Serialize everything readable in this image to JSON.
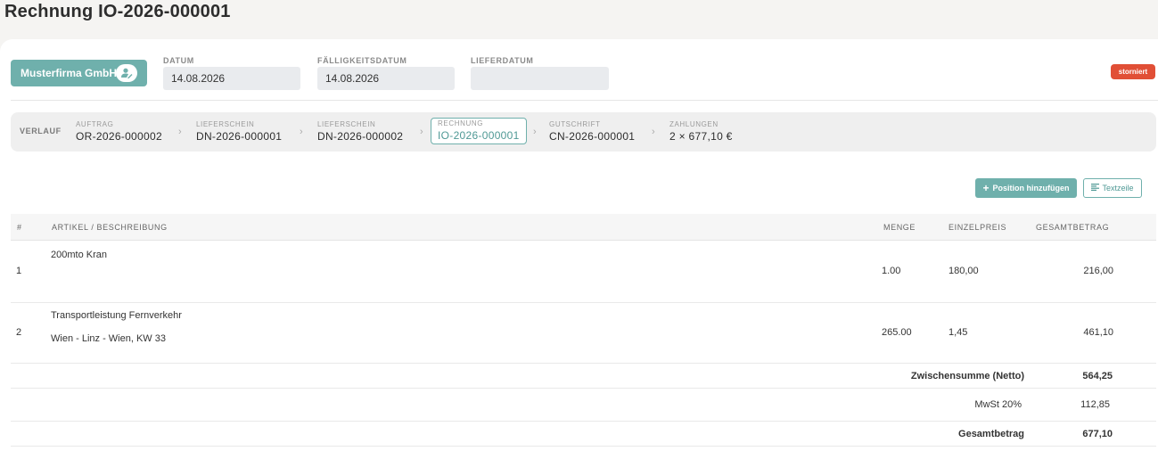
{
  "page": {
    "title": "Rechnung IO-2026-000001"
  },
  "header": {
    "customer": "Musterfirma GmbH",
    "date": {
      "label": "DATUM",
      "value": "14.08.2026"
    },
    "due_date": {
      "label": "FÄLLIGKEITSDATUM",
      "value": "14.08.2026"
    },
    "delivery_date": {
      "label": "LIEFERDATUM",
      "value": ""
    },
    "status": "storniert"
  },
  "history": {
    "title": "VERLAUF",
    "steps": [
      {
        "label": "AUFTRAG",
        "value": "OR-2026-000002"
      },
      {
        "label": "LIEFERSCHEIN",
        "value": "DN-2026-000001"
      },
      {
        "label": "LIEFERSCHEIN",
        "value": "DN-2026-000002"
      },
      {
        "label": "RECHNUNG",
        "value": "IO-2026-000001",
        "active": true
      },
      {
        "label": "GUTSCHRIFT",
        "value": "CN-2026-000001"
      },
      {
        "label": "ZAHLUNGEN",
        "value": "2 × 677,10 €"
      }
    ]
  },
  "actions": {
    "add_position": "Position hinzufügen",
    "text_line": "Textzeile"
  },
  "table": {
    "columns": [
      "#",
      "ARTIKEL / BESCHREIBUNG",
      "MENGE",
      "EINZELPREIS",
      "GESAMTBETRAG"
    ],
    "rows": [
      {
        "no": "1",
        "title": "200mto Kran",
        "description": "",
        "qty": "1.00",
        "unit_price": "180,00",
        "total": "216,00"
      },
      {
        "no": "2",
        "title": "Transportleistung Fernverkehr",
        "description": "Wien - Linz - Wien, KW 33",
        "qty": "265.00",
        "unit_price": "1,45",
        "total": "461,10"
      }
    ]
  },
  "totals": {
    "subtotal_label": "Zwischensumme (Netto)",
    "subtotal": "564,25",
    "tax_label": "MwSt 20%",
    "tax": "112,85",
    "total_label": "Gesamtbetrag",
    "total": "677,10"
  },
  "colors": {
    "accent": "#6fb0ac",
    "status": "#e14f36"
  }
}
